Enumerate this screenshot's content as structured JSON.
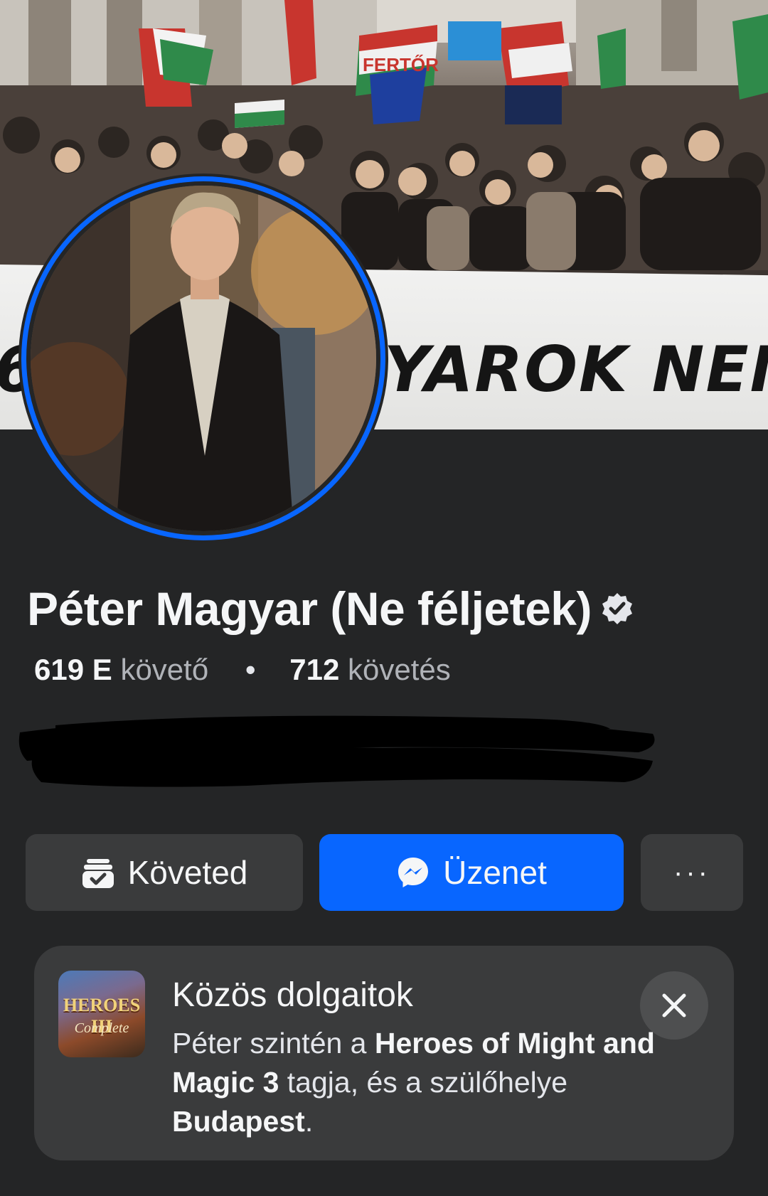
{
  "cover": {
    "banner_text": "YAROK NEM",
    "banner_text_left": "6",
    "flag_sign_text": "FERTŐR"
  },
  "profile": {
    "name": "Péter Magyar (Ne féljetek)",
    "followers_value": "619 E",
    "followers_label": "követő",
    "following_value": "712",
    "following_label": "követés"
  },
  "actions": {
    "follow_label": "Követed",
    "message_label": "Üzenet",
    "more_label": "···"
  },
  "common": {
    "title": "Közös dolgaitok",
    "body_pre": "Péter szintén a ",
    "group_name": "Heroes of Might and Magic 3",
    "body_mid": " tagja, és a szülőhelye ",
    "city": "Budapest",
    "body_end": ".",
    "thumb_title": "HEROES III",
    "thumb_sub": "Complete"
  },
  "colors": {
    "background": "#242526",
    "accent": "#0866ff",
    "secondary_button": "#3a3b3c"
  }
}
